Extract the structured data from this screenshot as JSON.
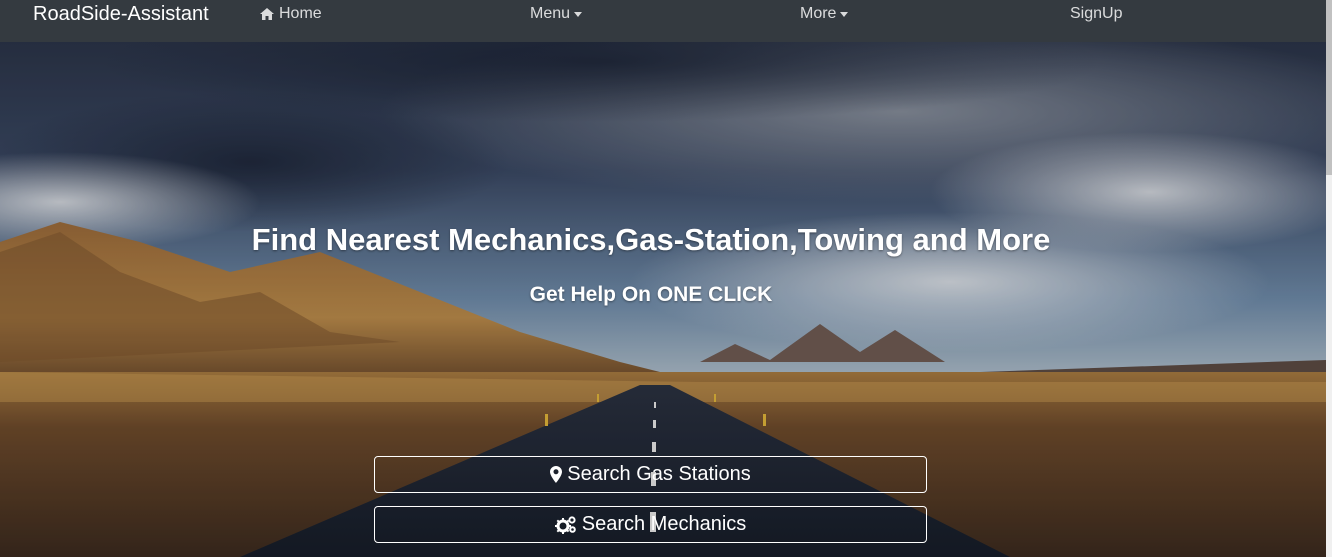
{
  "navbar": {
    "brand": "RoadSide-Assistant",
    "home": "Home",
    "menu": "Menu",
    "more": "More",
    "signup": "SignUp"
  },
  "hero": {
    "headline": "Find Nearest Mechanics,Gas-Station,Towing and More",
    "subheadline": "Get Help On ONE CLICK",
    "buttons": {
      "gas": "Search Gas Stations",
      "mechanics": "Search Mechanics"
    }
  },
  "icons": {
    "home": "home-icon",
    "caret": "caret-down-icon",
    "map_marker": "map-marker-icon",
    "gears": "gears-icon"
  }
}
